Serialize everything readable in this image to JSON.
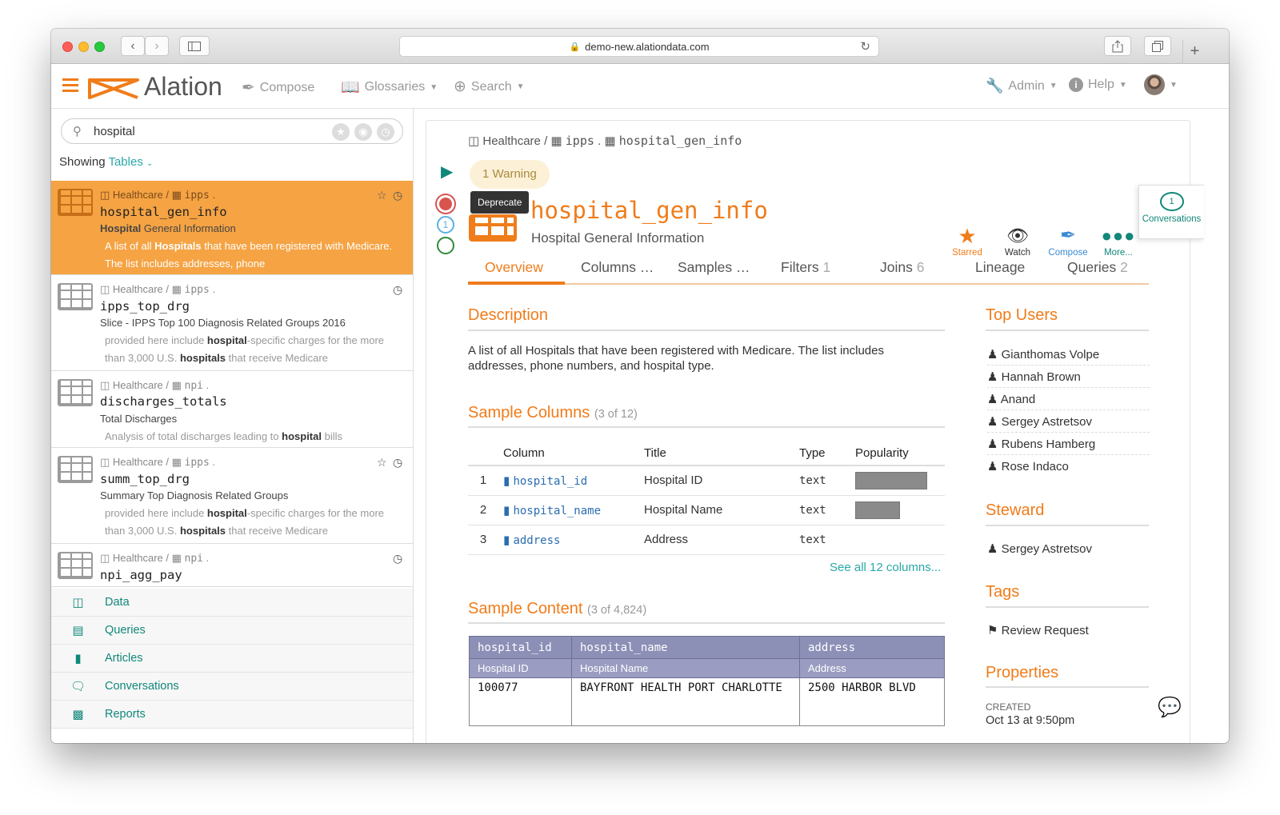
{
  "browser": {
    "url": "demo-new.alationdata.com"
  },
  "topnav": {
    "brand": "Alation",
    "compose": "Compose",
    "glossaries": "Glossaries",
    "search": "Search",
    "admin": "Admin",
    "help": "Help"
  },
  "left": {
    "search_value": "hospital",
    "showing_label": "Showing",
    "showing_value": "Tables",
    "results": [
      {
        "db": "Healthcare",
        "schema": "ipps",
        "name": "hospital_gen_info",
        "title_bold": "Hospital",
        "title_rest": " General Information",
        "desc_parts": [
          "A list of all ",
          "Hospitals",
          " that have been registered with Medicare. The list includes addresses, phone"
        ],
        "starred": true
      },
      {
        "db": "Healthcare",
        "schema": "ipps",
        "name": "ipps_top_drg",
        "title": "Slice - IPPS Top 100 Diagnosis Related Groups 2016",
        "desc_parts": [
          "provided here include ",
          "hospital",
          "-specific charges for the more than 3,000 U.S. ",
          "hospitals",
          " that receive Medicare"
        ]
      },
      {
        "db": "Healthcare",
        "schema": "npi",
        "name": "discharges_totals",
        "title": "Total Discharges",
        "desc_parts": [
          "Analysis of total discharges leading to ",
          "hospital",
          " bills"
        ]
      },
      {
        "db": "Healthcare",
        "schema": "ipps",
        "name": "summ_top_drg",
        "title": "Summary Top Diagnosis Related Groups",
        "desc_parts": [
          "provided here include ",
          "hospital",
          "-specific charges for the more than 3,000 U.S. ",
          "hospitals",
          " that receive Medicare"
        ],
        "starred": true
      },
      {
        "db": "Healthcare",
        "schema": "npi",
        "name": "npi_agg_pay"
      }
    ],
    "nav": [
      "Data",
      "Queries",
      "Articles",
      "Conversations",
      "Reports"
    ]
  },
  "main": {
    "breadcrumb": {
      "db": "Healthcare",
      "schema": "ipps",
      "table": "hospital_gen_info"
    },
    "warning": "1 Warning",
    "tooltip": "Deprecate",
    "flag_count": "1",
    "title": "hospital_gen_info",
    "subtitle": "Hospital General Information",
    "actions": {
      "starred": "Starred",
      "watch": "Watch",
      "compose": "Compose",
      "more": "More...",
      "conversations": "Conversations",
      "conversations_count": "1"
    },
    "tabs": [
      {
        "label": "Overview",
        "count": ""
      },
      {
        "label": "Columns …",
        "count": ""
      },
      {
        "label": "Samples …",
        "count": ""
      },
      {
        "label": "Filters",
        "count": "1"
      },
      {
        "label": "Joins",
        "count": "6"
      },
      {
        "label": "Lineage",
        "count": ""
      },
      {
        "label": "Queries",
        "count": "2"
      }
    ],
    "description_heading": "Description",
    "description": "A list of all Hospitals that have been registered with Medicare. The list includes addresses, phone numbers, and hospital type.",
    "sample_columns_heading": "Sample Columns",
    "sample_columns_count": "(3 of 12)",
    "columns_headers": [
      "Column",
      "Title",
      "Type",
      "Popularity"
    ],
    "columns": [
      {
        "n": "1",
        "name": "hospital_id",
        "title": "Hospital ID",
        "type": "text",
        "popularity": 1.0
      },
      {
        "n": "2",
        "name": "hospital_name",
        "title": "Hospital Name",
        "type": "text",
        "popularity": 0.62
      },
      {
        "n": "3",
        "name": "address",
        "title": "Address",
        "type": "text",
        "popularity": 0
      }
    ],
    "see_all": "See all 12 columns...",
    "sample_content_heading": "Sample Content",
    "sample_content_count": "(3 of 4,824)",
    "sample_headers": [
      "hospital_id",
      "hospital_name",
      "address"
    ],
    "sample_subheaders": [
      "Hospital ID",
      "Hospital Name",
      "Address"
    ],
    "sample_rows": [
      [
        "100077",
        "BAYFRONT HEALTH PORT CHARLOTTE",
        "2500 HARBOR BLVD"
      ]
    ]
  },
  "sidebar": {
    "top_users_heading": "Top Users",
    "top_users": [
      "Gianthomas Volpe",
      "Hannah Brown",
      "Anand",
      "Sergey Astretsov",
      "Rubens Hamberg",
      "Rose Indaco"
    ],
    "steward_heading": "Steward",
    "steward": "Sergey Astretsov",
    "tags_heading": "Tags",
    "tag": "Review Request",
    "properties_heading": "Properties",
    "created_label": "CREATED",
    "created_value": "Oct 13 at 9:50pm"
  },
  "colors": {
    "accent": "#f07c1a",
    "teal": "#2aa8a8",
    "selected": "#f5a343"
  }
}
